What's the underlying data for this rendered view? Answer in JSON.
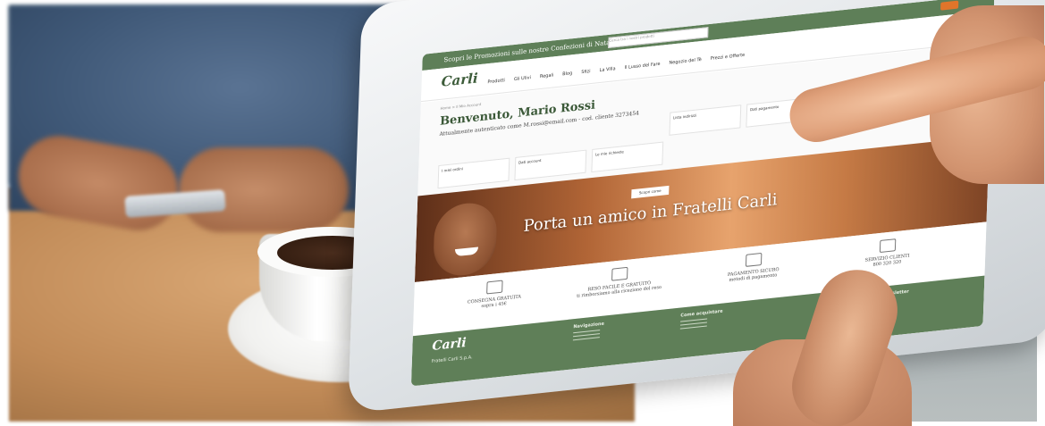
{
  "screen": {
    "promo_text": "Scopri le Promozioni sulle nostre Confezioni di Natale!",
    "search_placeholder": "Cerca tra i nostri prodotti",
    "logo": "Carli",
    "nav": [
      "Prodotti",
      "Gli Ulivi",
      "Regali",
      "Blog",
      "Sfizi",
      "La Villa",
      "Il Lusso del Fare",
      "Negozio del Tè",
      "Prezzi e Offerte"
    ],
    "breadcrumb": "Home > Il Mio Account",
    "welcome_title": "Benvenuto, Mario Rossi",
    "welcome_sub": "Attualmente autenticato come M.rossi@email.com - cod. cliente 3273454",
    "account_boxes": [
      "I miei ordini",
      "Dati account",
      "Le mie richieste",
      "Lista indirizzi",
      "Dati pagamento"
    ],
    "hero_text": "Porta un amico in Fratelli Carli",
    "hero_cta": "Scopri come",
    "features": [
      {
        "title": "CONSEGNA GRATUITA",
        "sub": "sopra i 45€"
      },
      {
        "title": "RESO FACILE E GRATUITO",
        "sub": "ti rimborsiamo alla ricezione del reso"
      },
      {
        "title": "PAGAMENTO SICURO",
        "sub": "metodi di pagamento"
      },
      {
        "title": "SERVIZIO CLIENTI",
        "sub": "800 320 320"
      }
    ],
    "footer": {
      "logo": "Carli",
      "company": "Fratelli Carli S.p.A.",
      "col1_title": "Navigazione",
      "col2_title": "Come acquistare",
      "col3_title": "Iscriviti alla nostra Newsletter"
    }
  }
}
